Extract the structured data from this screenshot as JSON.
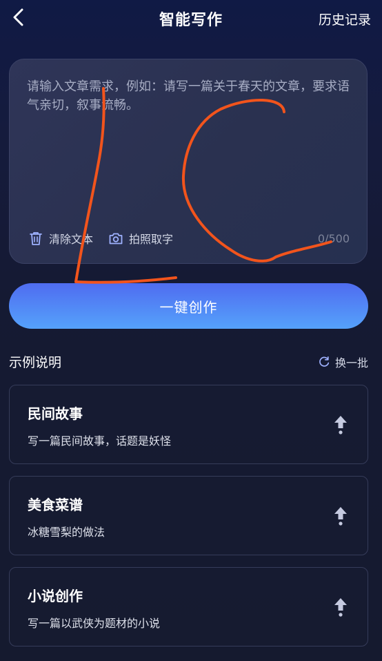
{
  "header": {
    "title": "智能写作",
    "history_label": "历史记录",
    "back_icon": "chevron-left-icon"
  },
  "input": {
    "placeholder": "请输入文章需求，例如：请写一篇关于春天的文章，要求语气亲切，叙事流畅。",
    "value": "",
    "clear_label": "清除文本",
    "clear_icon": "trash-icon",
    "photo_label": "拍照取字",
    "photo_icon": "camera-icon",
    "counter": "0/500"
  },
  "generate_label": "一键创作",
  "examples": {
    "title": "示例说明",
    "refresh_label": "换一批",
    "refresh_icon": "refresh-icon",
    "items": [
      {
        "title": "民间故事",
        "desc": "写一篇民间故事，话题是妖怪"
      },
      {
        "title": "美食菜谱",
        "desc": "冰糖雪梨的做法"
      },
      {
        "title": "小说创作",
        "desc": "写一篇以武侠为题材的小说"
      }
    ]
  },
  "colors": {
    "accent_gradient_start": "#4f6cf0",
    "accent_gradient_end": "#55a2fb",
    "background": "#151a33",
    "annotation_stroke": "#f2541c"
  }
}
